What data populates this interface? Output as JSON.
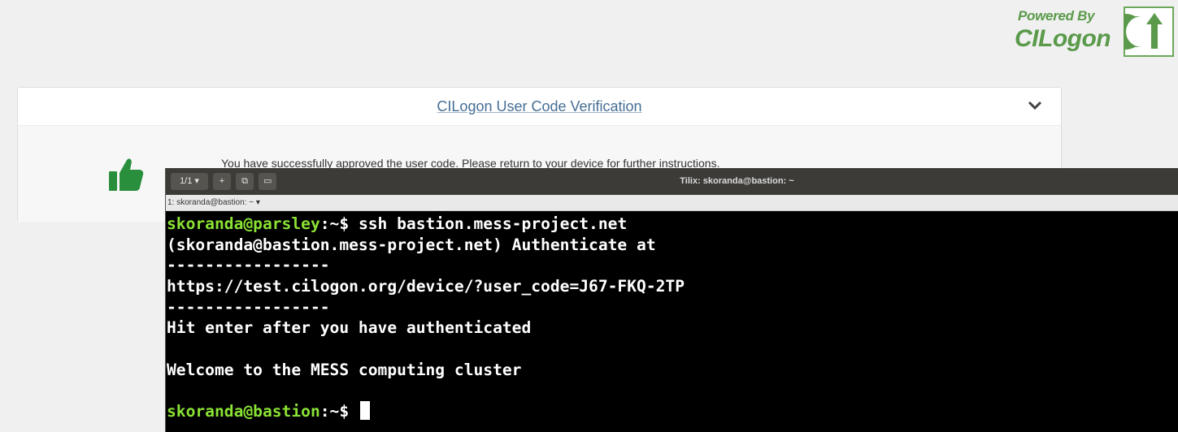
{
  "brand": {
    "powered_by": "Powered By",
    "name": "CILogon",
    "logo_icon": "cilogon-logo-icon",
    "color": "#5a9a4a"
  },
  "card": {
    "title": "CILogon User Code Verification",
    "toggle_icon": "chevron-down-icon",
    "status_icon": "thumbs-up-icon",
    "message": "You have successfully approved the user code. Please return to your device for further instructions."
  },
  "terminal": {
    "window_title": "Tilix: skoranda@bastion: ~",
    "session_label": "1/1",
    "tab_label": "1: skoranda@bastion: ~",
    "lines": [
      {
        "prompt": "skoranda@parsley",
        "sep": ":~$ ",
        "text": "ssh bastion.mess-project.net"
      },
      {
        "text": "(skoranda@bastion.mess-project.net) Authenticate at"
      },
      {
        "text": "-----------------"
      },
      {
        "text": "https://test.cilogon.org/device/?user_code=J67-FKQ-2TP"
      },
      {
        "text": "-----------------"
      },
      {
        "text": "Hit enter after you have authenticated"
      },
      {
        "text": ""
      },
      {
        "text": "Welcome to the MESS computing cluster"
      },
      {
        "text": ""
      },
      {
        "prompt": "skoranda@bastion",
        "sep": ":~$ ",
        "text": ""
      }
    ],
    "prompt_color": "#8ae234"
  }
}
